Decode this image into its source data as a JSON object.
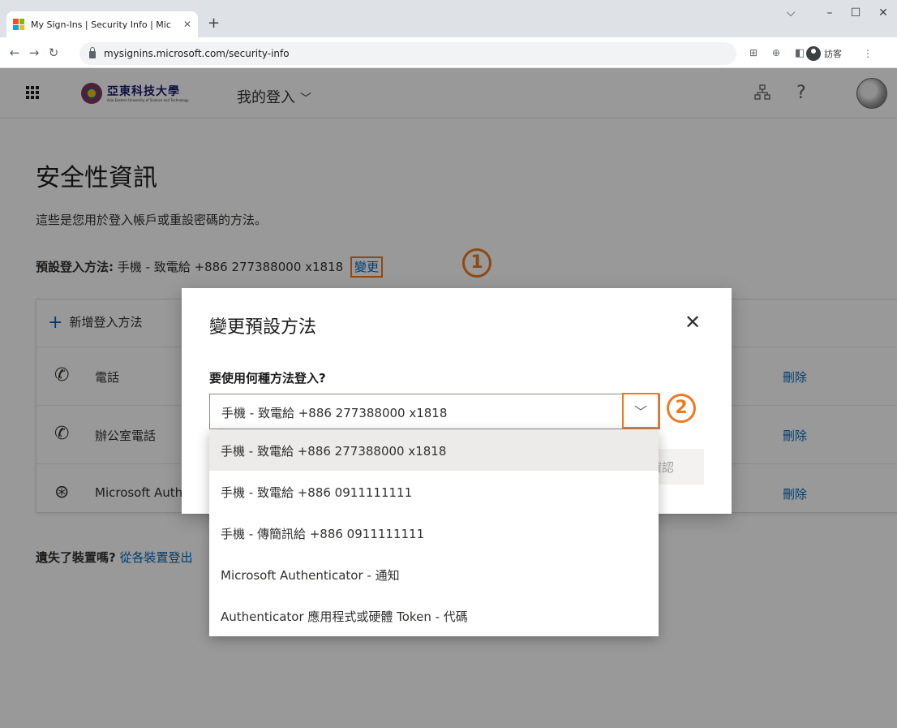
{
  "browser": {
    "tab_title": "My Sign-Ins | Security Info | Mic",
    "tab_close": "✕",
    "new_tab": "+",
    "url": "mysignins.microsoft.com/security-info",
    "profile_label": "訪客",
    "window_minimize": "–",
    "window_maximize": "☐",
    "window_close": "✕",
    "window_dropdown": "⌵"
  },
  "header": {
    "org_name": "亞東科技大學",
    "org_subtitle": "Asia Eastern University of Science and Technology",
    "app_title": "我的登入",
    "chevron": "﹀",
    "org_icon": "org-chart-icon",
    "help": "?"
  },
  "main": {
    "page_title": "安全性資訊",
    "description": "這些是您用於登入帳戶或重設密碼的方法。",
    "default_label": "預設登入方法:",
    "default_value": "手機 - 致電給 +886 277388000 x1818",
    "change_link": "變更",
    "badge_1": "1",
    "add_method": "新增登入方法",
    "methods": [
      {
        "icon": "phone-icon",
        "name": "電話",
        "action": "刪除"
      },
      {
        "icon": "phone-icon",
        "name": "辦公室電話",
        "action": "刪除"
      },
      {
        "icon": "authenticator-icon",
        "name": "Microsoft Authenticator",
        "action": "刪除"
      }
    ],
    "lost_device_label": "遺失了裝置嗎?",
    "lost_device_link": "從各裝置登出"
  },
  "dialog": {
    "title": "變更預設方法",
    "close": "✕",
    "label": "要使用何種方法登入?",
    "selected_value": "手機 - 致電給 +886 277388000 x1818",
    "chevron": "﹀",
    "badge_2": "2",
    "confirm_button": "確認"
  },
  "dropdown": {
    "options": [
      "手機 - 致電給 +886 277388000 x1818",
      "手機 - 致電給 +886 0911111111",
      "手機 - 傳簡訊給 +886 0911111111",
      "Microsoft Authenticator - 通知",
      "Authenticator 應用程式或硬體 Token - 代碼"
    ],
    "selected_index": 0
  },
  "colors": {
    "accent": "#0067b8",
    "highlight": "#f07a20",
    "ms_red": "#f25022",
    "ms_green": "#7fba00",
    "ms_blue": "#00a4ef",
    "ms_yellow": "#ffb900"
  }
}
